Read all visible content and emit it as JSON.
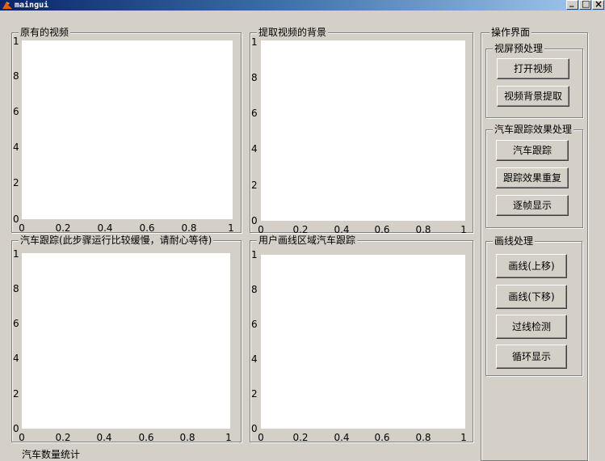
{
  "window": {
    "title": "maingui",
    "minimize_glyph": "_",
    "maximize_glyph": "□",
    "close_glyph": "×"
  },
  "axes": [
    {
      "title": "原有的视频",
      "yticks": [
        "0",
        "2",
        "4",
        "6",
        "8",
        "1"
      ],
      "xticks": [
        "0",
        "0.2",
        "0.4",
        "0.6",
        "0.8",
        "1"
      ]
    },
    {
      "title": "提取视频的背景",
      "yticks": [
        "0",
        "2",
        "4",
        "6",
        "8",
        "1"
      ],
      "xticks": [
        "0",
        "0.2",
        "0.4",
        "0.6",
        "0.8",
        "1"
      ]
    },
    {
      "title": "汽车跟踪(此步骤运行比较缓慢，请耐心等待)",
      "yticks": [
        "0",
        "2",
        "4",
        "6",
        "8",
        "1"
      ],
      "xticks": [
        "0",
        "0.2",
        "0.4",
        "0.6",
        "0.8",
        "1"
      ]
    },
    {
      "title": "用户画线区域汽车跟踪",
      "yticks": [
        "0",
        "2",
        "4",
        "6",
        "8",
        "1"
      ],
      "xticks": [
        "0",
        "0.2",
        "0.4",
        "0.6",
        "0.8",
        "1"
      ]
    }
  ],
  "control_panel": {
    "title": "操作界面",
    "video_preprocess": {
      "title": "视屏预处理",
      "open_video": "打开视频",
      "extract_background": "视频背景提取"
    },
    "tracking_effect": {
      "title": "汽车跟踪效果处理",
      "car_tracking": "汽车跟踪",
      "repeat_effect": "跟踪效果重复",
      "frame_by_frame": "逐帧显示"
    },
    "line_processing": {
      "title": "画线处理",
      "line_up": "画线(上移)",
      "line_down": "画线(下移)",
      "crossing_detect": "过线检测",
      "loop_display": "循环显示"
    }
  },
  "bottom": {
    "stats_label": "汽车数量统计"
  },
  "colors": {
    "background": "#d4d0c8",
    "titlebar_start": "#0a246a",
    "titlebar_end": "#a6caf0",
    "plot_bg": "#ffffff"
  }
}
